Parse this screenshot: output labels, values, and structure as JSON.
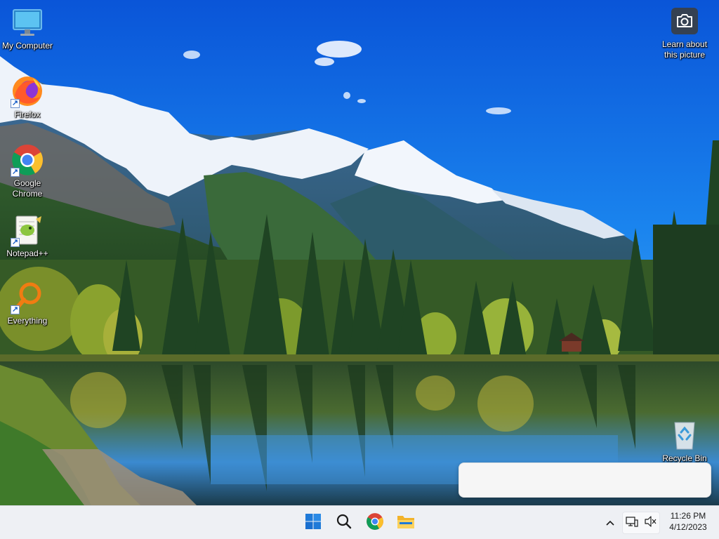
{
  "desktop": {
    "icons": [
      {
        "label": "My Computer",
        "icon": "monitor-icon"
      },
      {
        "label": "Firefox",
        "icon": "firefox-icon"
      },
      {
        "label": "Google Chrome",
        "icon": "chrome-icon"
      },
      {
        "label": "Notepad++",
        "icon": "notepadpp-icon"
      },
      {
        "label": "Everything",
        "icon": "everything-search-icon"
      },
      {
        "label": "Recycle Bin",
        "icon": "recycle-bin-icon"
      }
    ],
    "learn_picture": {
      "label": "Learn about this picture",
      "icon": "camera-icon"
    }
  },
  "taskbar": {
    "pinned": [
      {
        "name": "Start",
        "icon": "windows-start-icon"
      },
      {
        "name": "Search",
        "icon": "search-icon"
      },
      {
        "name": "Google Chrome",
        "icon": "chrome-icon"
      },
      {
        "name": "File Explorer",
        "icon": "folder-icon"
      }
    ],
    "tray_icons": [
      "show-hidden-icons-chevron",
      "network-icon",
      "volume-icon"
    ],
    "clock": {
      "time": "11:26 PM",
      "date": "4/12/2023"
    }
  },
  "colors": {
    "taskbar_bg": "#eef0f4",
    "sky_top": "#0a5fe0",
    "windows_blue": "#1f7ad8"
  }
}
